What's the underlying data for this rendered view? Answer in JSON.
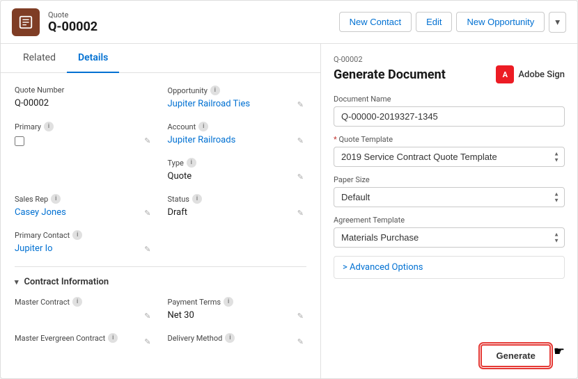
{
  "header": {
    "subtitle": "Quote",
    "title": "Q-00002",
    "icon_char": "🛒",
    "buttons": {
      "new_contact": "New Contact",
      "edit": "Edit",
      "new_opportunity": "New Opportunity"
    }
  },
  "tabs": {
    "related": "Related",
    "details": "Details"
  },
  "form": {
    "fields": {
      "quote_number_label": "Quote Number",
      "quote_number_value": "Q-00002",
      "primary_label": "Primary",
      "opportunity_label": "Opportunity",
      "opportunity_value": "Jupiter Railroad Ties",
      "account_label": "Account",
      "account_value": "Jupiter Railroads",
      "type_label": "Type",
      "type_value": "Quote",
      "sales_rep_label": "Sales Rep",
      "sales_rep_value": "Casey Jones",
      "status_label": "Status",
      "status_value": "Draft",
      "primary_contact_label": "Primary Contact",
      "primary_contact_value": "Jupiter Io"
    },
    "section": {
      "contract_info": "Contract Information",
      "master_contract_label": "Master Contract",
      "payment_terms_label": "Payment Terms",
      "payment_terms_value": "Net 30",
      "master_evergreen_label": "Master Evergreen Contract",
      "delivery_method_label": "Delivery Method"
    }
  },
  "right_panel": {
    "id": "Q-00002",
    "title": "Generate Document",
    "adobe_sign_label": "Adobe Sign",
    "adobe_icon_char": "A",
    "document_name_label": "Document Name",
    "document_name_value": "Q-00000-2019327-1345",
    "quote_template_label": "Quote Template",
    "quote_template_required": true,
    "quote_template_value": "2019 Service Contract Quote Template",
    "paper_size_label": "Paper Size",
    "paper_size_value": "Default",
    "agreement_template_label": "Agreement Template",
    "agreement_template_value": "Materials Purchase",
    "advanced_options_label": "> Advanced Options",
    "generate_button": "Generate"
  },
  "icons": {
    "info": "i",
    "chevron_down": "▾",
    "select_up": "▲",
    "select_down": "▼",
    "edit_pencil": "✎",
    "caret_right": ">"
  }
}
